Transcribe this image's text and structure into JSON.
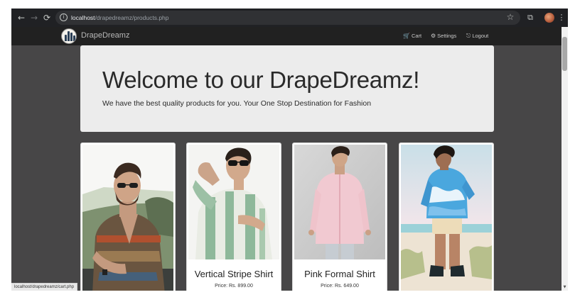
{
  "browser": {
    "back_icon": "←",
    "forward_icon": "→",
    "reload_icon": "⟳",
    "url_host": "localhost",
    "url_path": "/drapedreamz/products.php",
    "star_icon": "☆",
    "extensions_icon": "⧉",
    "menu_icon": "⋮"
  },
  "navbar": {
    "brand": "DrapeDreamz",
    "cart_label": "Cart",
    "settings_label": "Settings",
    "logout_label": "Logout",
    "cart_icon": "🛒",
    "settings_icon": "⚙",
    "logout_icon": "⎋"
  },
  "jumbotron": {
    "title": "Welcome to our DrapeDreamz!",
    "subtitle": "We have the best quality products for you. Your One Stop Destination for Fashion"
  },
  "products": [
    {
      "name": "",
      "price": ""
    },
    {
      "name": "Vertical Stripe Shirt",
      "price": "Price: Rs. 899.00"
    },
    {
      "name": "Pink Formal Shirt",
      "price": "Price: Rs. 649.00"
    },
    {
      "name": "",
      "price": ""
    }
  ],
  "status_url": "localhost/drapedreamz/cart.php",
  "colors": {
    "page_background": "#474647",
    "navbar": "#212121",
    "jumbotron": "#ececec",
    "browser_chrome": "#202124"
  }
}
